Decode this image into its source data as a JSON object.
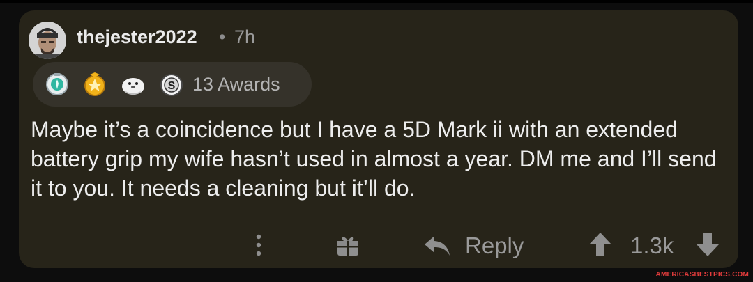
{
  "comment": {
    "username": "thejester2022",
    "separator": "•",
    "timestamp": "7h",
    "awards_count": "13 Awards",
    "awards": [
      "rocket-like-award-icon",
      "gold-star-award-icon",
      "seal-award-icon",
      "silver-award-icon"
    ],
    "body": "Maybe it’s a coincidence but I have a 5D Mark ii with an extended battery grip my wife hasn’t used in almost a year. DM me and I’ll send it to you. It needs a cleaning but it’ll do."
  },
  "actions": {
    "reply_label": "Reply",
    "score": "1.3k"
  },
  "watermark": "AMERICASBESTPICS.COM",
  "colors": {
    "card_background": "#272419",
    "awards_pill": "#35322a",
    "text": "#ededed",
    "muted": "#9a9a9a",
    "watermark": "#e23c3c"
  }
}
